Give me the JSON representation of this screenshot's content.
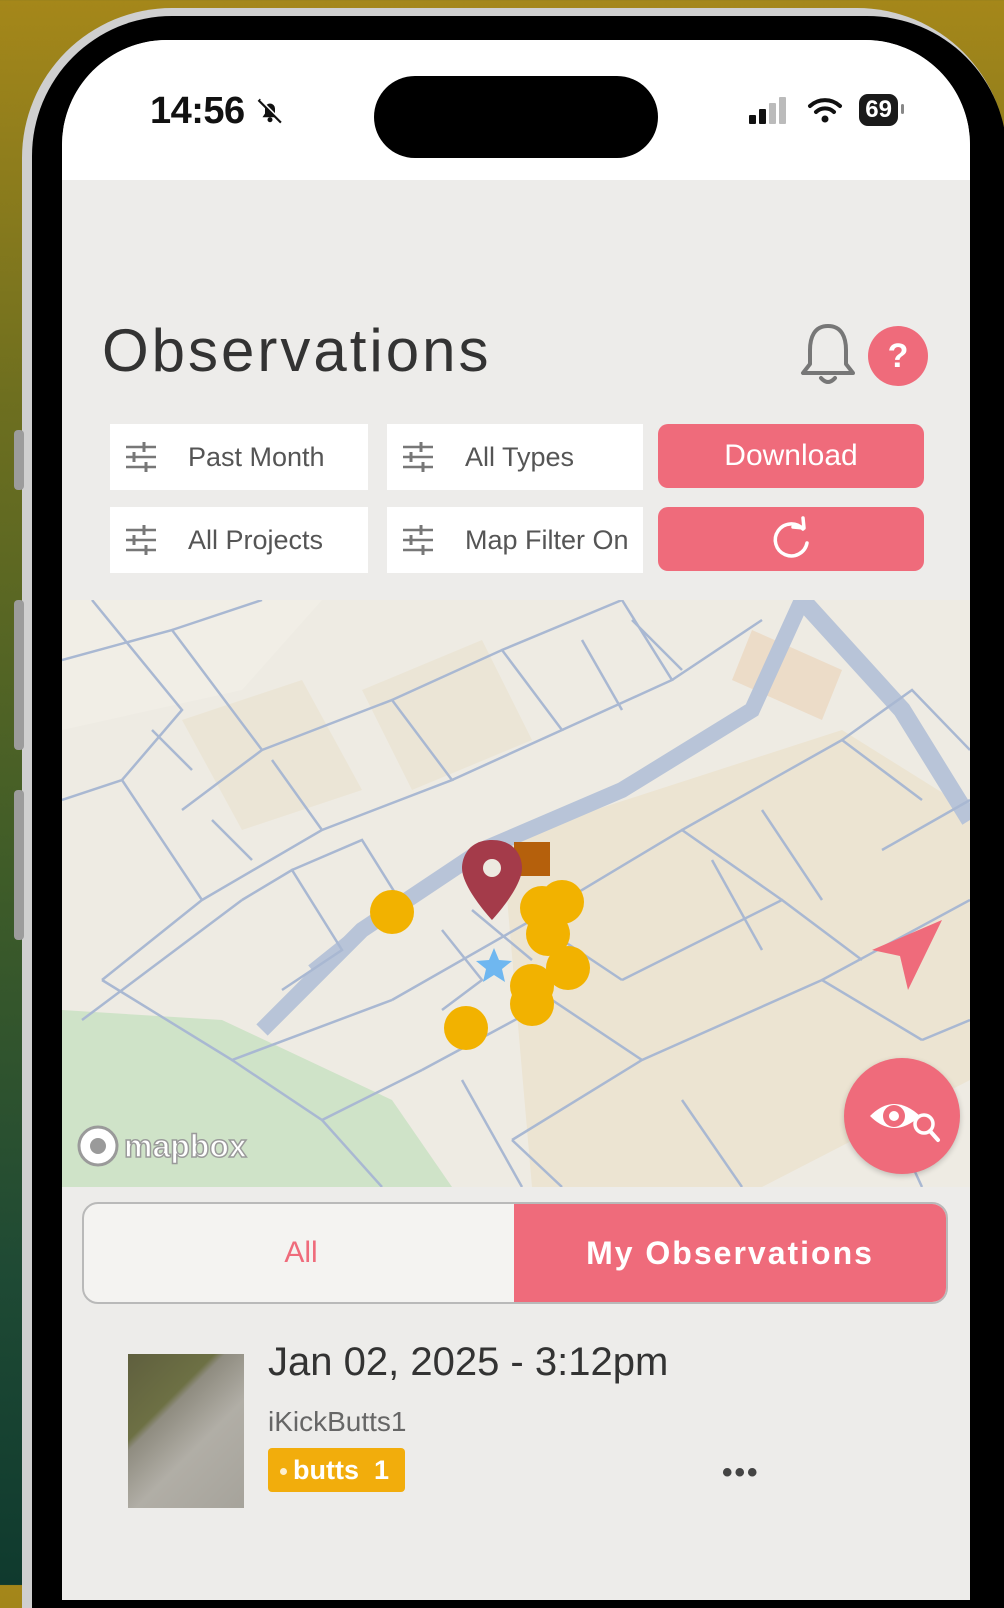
{
  "status_bar": {
    "time": "14:56",
    "battery": "69"
  },
  "header": {
    "title": "Observations",
    "help_label": "?"
  },
  "filters": {
    "time_range": "Past Month",
    "types": "All Types",
    "projects": "All Projects",
    "map_filter": "Map Filter On"
  },
  "actions": {
    "download_label": "Download"
  },
  "map": {
    "attribution": "mapbox"
  },
  "segment": {
    "all_label": "All",
    "mine_label": "My Observations",
    "selected": "My Observations"
  },
  "observations": [
    {
      "date": "Jan 02, 2025 - 3:12pm",
      "user": "iKickButts1",
      "tag_label": "butts",
      "tag_count": "1",
      "more": "•••"
    }
  ],
  "colors": {
    "accent": "#ef6b7b",
    "marker": "#f2b200",
    "pin": "#a43b4a",
    "star": "#6fb7f0",
    "square": "#b5600c"
  }
}
